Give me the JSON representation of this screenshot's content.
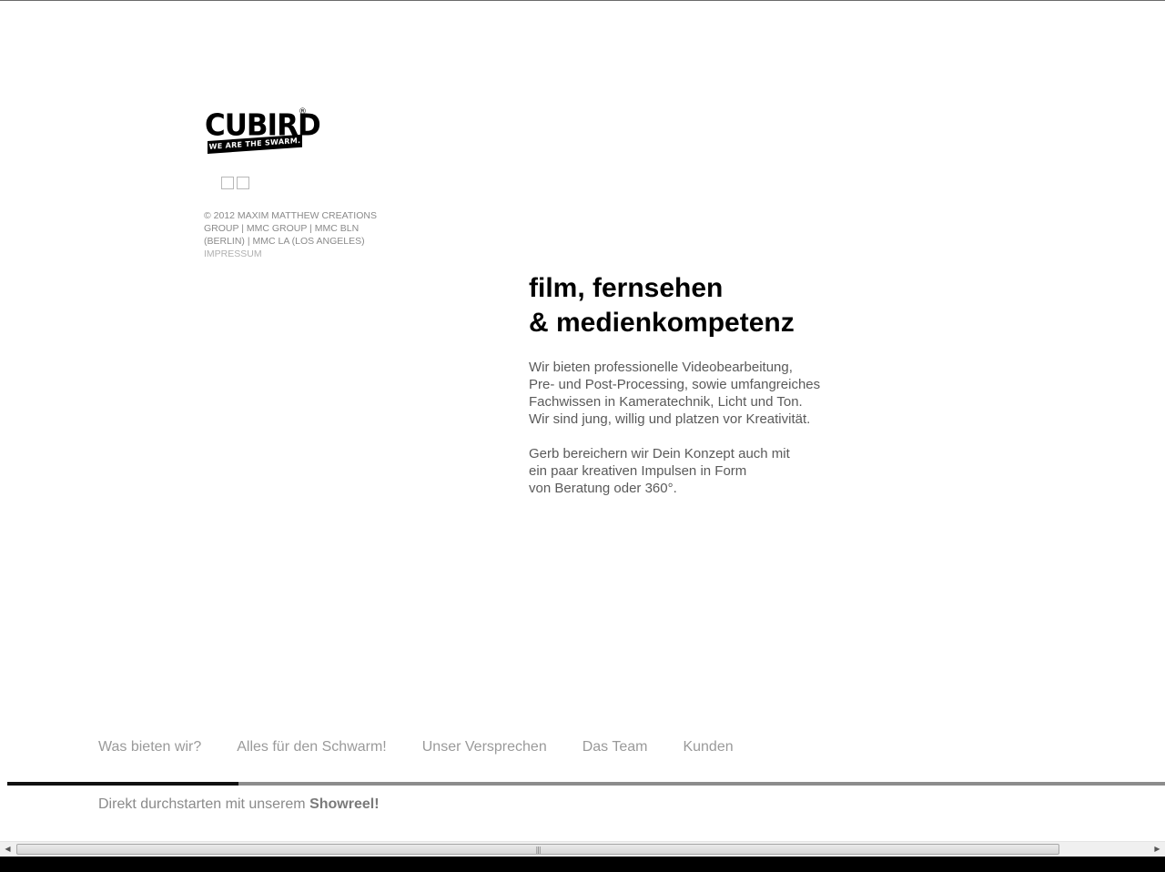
{
  "logo": {
    "word": "CUBIRD",
    "registered": "®",
    "tagline": "WE ARE THE SWARM."
  },
  "social": {
    "items": [
      "social-link-1",
      "social-link-2"
    ]
  },
  "footer_info": {
    "copyright_lines": [
      "© 2012 MAXIM MATTHEW CREATIONS",
      "GROUP | MMC GROUP | MMC BLN",
      "(BERLIN) | MMC LA (LOS ANGELES)"
    ],
    "impressum": "IMPRESSUM"
  },
  "main": {
    "headline_lines": [
      "film, fernsehen",
      "& medienkompetenz"
    ],
    "paragraph1_lines": [
      "Wir bieten professionelle Videobearbeitung,",
      "Pre- und Post-Processing, sowie umfangreiches",
      "Fachwissen in Kameratechnik, Licht und Ton.",
      "Wir sind jung, willig und platzen vor Kreativität."
    ],
    "paragraph2_lines": [
      "Gerb bereichern wir Dein Konzept auch mit",
      "ein paar kreativen Impulsen in Form",
      "von Beratung oder 360°."
    ]
  },
  "nav": {
    "items": [
      {
        "label": "Was bieten wir?"
      },
      {
        "label": "Alles für den Schwarm!"
      },
      {
        "label": "Unser Versprechen"
      },
      {
        "label": "Das Team"
      },
      {
        "label": "Kunden"
      }
    ],
    "progress_fraction": 0.2
  },
  "showreel": {
    "prefix": "Direkt durchstarten mit unserem ",
    "link": "Showreel!"
  },
  "scrollbar": {
    "left_arrow": "◀",
    "right_arrow": "▶",
    "grip": "|||"
  },
  "colors": {
    "text_dark": "#000000",
    "text_gray": "#5a5a5a",
    "nav_gray": "#9a9a9a",
    "progress_track": "#8c8c8c",
    "progress_fill": "#111111"
  }
}
